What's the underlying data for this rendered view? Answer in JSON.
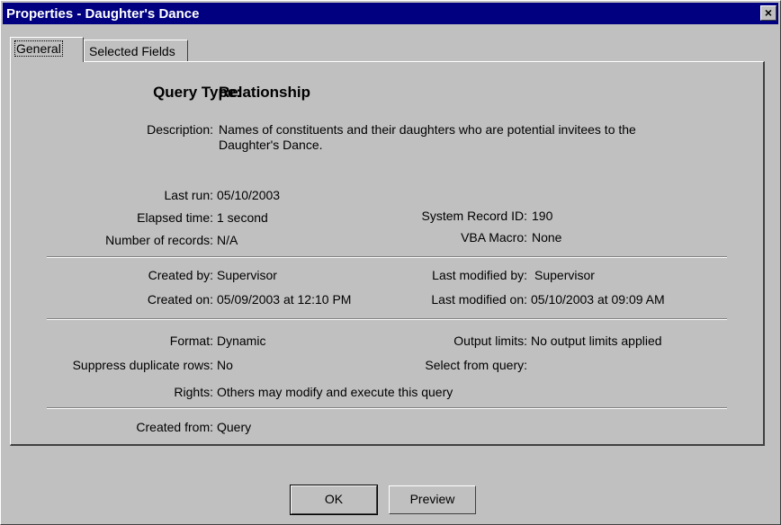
{
  "window": {
    "title": "Properties - Daughter's Dance",
    "close_glyph": "×"
  },
  "tabs": {
    "general": "General",
    "selected_fields": "Selected Fields"
  },
  "general": {
    "query_type_label": "Query Type:",
    "query_type_value": "Relationship",
    "description_label": "Description:",
    "description_value": "Names of constituents and their daughters who are potential invitees to the Daughter's Dance.",
    "last_run_label": "Last run:",
    "last_run_value": "05/10/2003",
    "elapsed_label": "Elapsed time:",
    "elapsed_value": "1 second",
    "num_records_label": "Number of records:",
    "num_records_value": "N/A",
    "system_record_id_label": "System Record ID:",
    "system_record_id_value": "190",
    "vba_macro_label": "VBA Macro:",
    "vba_macro_value": "None",
    "created_by_label": "Created by:",
    "created_by_value": "Supervisor",
    "created_on_label": "Created on:",
    "created_on_value": "05/09/2003 at 12:10 PM",
    "last_modified_by_label": "Last modified by:",
    "last_modified_by_value": "Supervisor",
    "last_modified_on_label": "Last modified on:",
    "last_modified_on_value": "05/10/2003 at 09:09 AM",
    "format_label": "Format:",
    "format_value": "Dynamic",
    "suppress_label": "Suppress duplicate rows:",
    "suppress_value": "No",
    "rights_label": "Rights:",
    "rights_value": "Others may modify and execute this query",
    "output_limits_label": "Output limits:",
    "output_limits_value": "No output limits applied",
    "select_from_query_label": "Select from query:",
    "select_from_query_value": "",
    "created_from_label": "Created from:",
    "created_from_value": "Query"
  },
  "buttons": {
    "ok": "OK",
    "preview": "Preview"
  }
}
